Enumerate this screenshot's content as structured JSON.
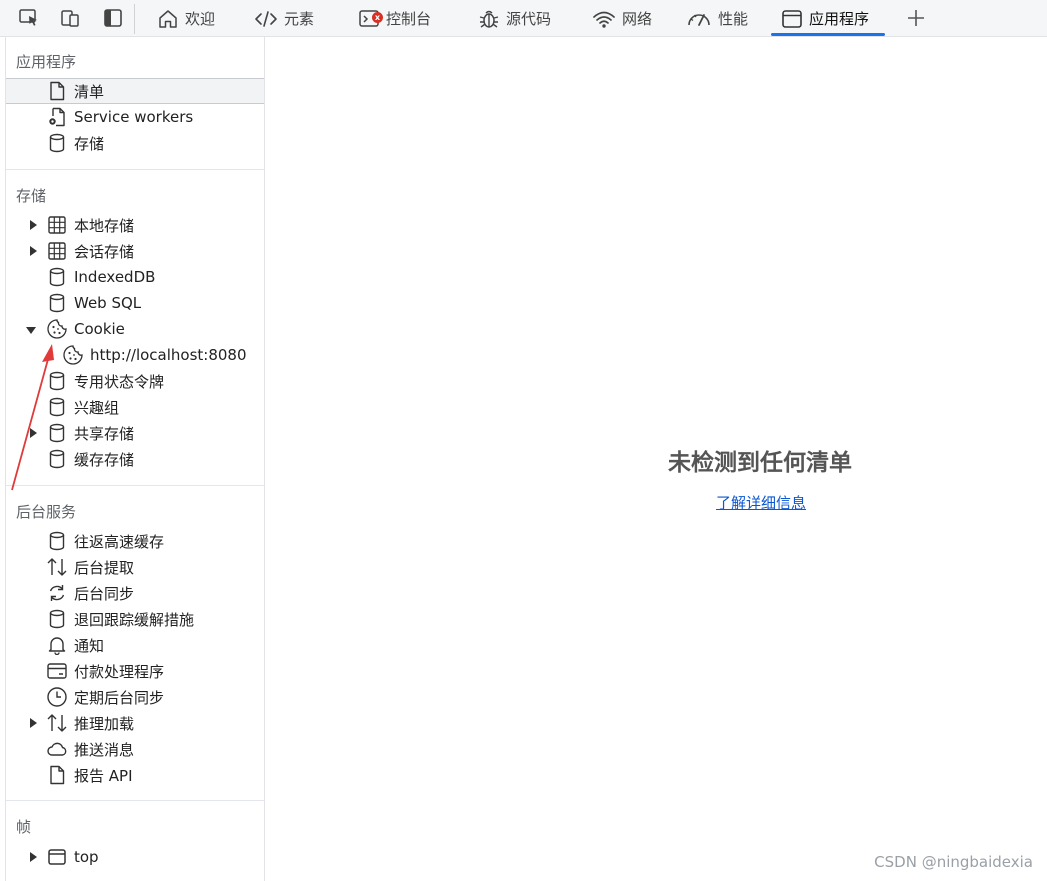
{
  "toolbar": {
    "tabs": [
      {
        "label": "欢迎",
        "icon": "home-icon"
      },
      {
        "label": "元素",
        "icon": "code-icon"
      },
      {
        "label": "控制台",
        "icon": "console-icon"
      },
      {
        "label": "源代码",
        "icon": "bug-icon"
      },
      {
        "label": "网络",
        "icon": "wifi-icon"
      },
      {
        "label": "性能",
        "icon": "gauge-icon"
      },
      {
        "label": "应用程序",
        "icon": "window-icon"
      }
    ],
    "active_tab": "应用程序",
    "accent_color": "#1a73e8",
    "error_badge": "x"
  },
  "sidebar": {
    "application": {
      "title": "应用程序",
      "items": [
        {
          "label": "清单",
          "icon": "file-icon"
        },
        {
          "label": "Service workers",
          "icon": "gear-file-icon"
        },
        {
          "label": "存储",
          "icon": "database-icon"
        }
      ]
    },
    "storage": {
      "title": "存储",
      "items": [
        {
          "label": "本地存储",
          "icon": "grid-icon"
        },
        {
          "label": "会话存储",
          "icon": "grid-icon"
        },
        {
          "label": "IndexedDB",
          "icon": "database-icon"
        },
        {
          "label": "Web SQL",
          "icon": "database-icon"
        },
        {
          "label": "Cookie",
          "icon": "cookie-icon"
        },
        {
          "label": "http://localhost:8080",
          "icon": "cookie-icon"
        },
        {
          "label": "专用状态令牌",
          "icon": "database-icon"
        },
        {
          "label": "兴趣组",
          "icon": "database-icon"
        },
        {
          "label": "共享存储",
          "icon": "database-icon"
        },
        {
          "label": "缓存存储",
          "icon": "database-icon"
        }
      ]
    },
    "background": {
      "title": "后台服务",
      "items": [
        {
          "label": "往返高速缓存",
          "icon": "database-icon"
        },
        {
          "label": "后台提取",
          "icon": "updown-arrows-icon"
        },
        {
          "label": "后台同步",
          "icon": "sync-icon"
        },
        {
          "label": "退回跟踪缓解措施",
          "icon": "database-icon"
        },
        {
          "label": "通知",
          "icon": "bell-icon"
        },
        {
          "label": "付款处理程序",
          "icon": "card-icon"
        },
        {
          "label": "定期后台同步",
          "icon": "clock-icon"
        },
        {
          "label": "推理加载",
          "icon": "updown-arrows-icon"
        },
        {
          "label": "推送消息",
          "icon": "cloud-icon"
        },
        {
          "label": "报告 API",
          "icon": "file-icon"
        }
      ]
    },
    "frames": {
      "title": "帧",
      "items": [
        {
          "label": "top",
          "icon": "window-icon"
        }
      ]
    }
  },
  "main": {
    "empty_title": "未检测到任何清单",
    "learn_more": "了解详细信息"
  },
  "watermark": "CSDN @ningbaidexia",
  "annotation_color": "#e03a3a"
}
